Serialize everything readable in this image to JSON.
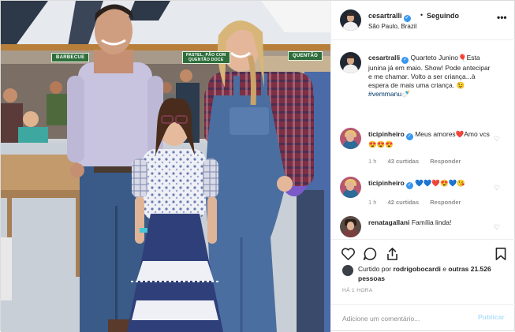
{
  "header": {
    "username": "cesartralli",
    "verified_mark": "✓",
    "separator": "•",
    "follow_status": "Seguindo",
    "location": "São Paulo, Brazil",
    "more_icon": "more-horizontal-icon"
  },
  "photo": {
    "signs": [
      "BARBECUE",
      "PASTEL, PÃO COM\nQUENTÃO DOCE",
      "QUENTÃO"
    ]
  },
  "comments": [
    {
      "username": "cesartralli",
      "verified": true,
      "text": "Quarteto Junino🎈Esta junina já em maio. Show! Pode antecipar e me chamar. Volto a ser criança...à espera de mais uma criança. 😉",
      "hashtag": "#vemmanu🍼",
      "time": "",
      "likes": "",
      "reply": ""
    },
    {
      "username": "ticipinheiro",
      "verified": true,
      "text": "Meus amores❤️Amo vcs 😍😍😍",
      "time": "1 h",
      "likes": "43 curtidas",
      "reply": "Responder"
    },
    {
      "username": "ticipinheiro",
      "verified": true,
      "text": "💙💙❤️😍💙😘",
      "time": "1 h",
      "likes": "42 curtidas",
      "reply": "Responder"
    },
    {
      "username": "renatagallani",
      "verified": false,
      "text": "Família linda!",
      "time": "",
      "likes": "",
      "reply": ""
    }
  ],
  "actions": {
    "icons": [
      "heart-icon",
      "comment-icon",
      "share-icon",
      "bookmark-icon"
    ]
  },
  "likes": {
    "prefix": "Curtido por",
    "user": "rodrigobocardi",
    "connector": "e",
    "others": "outras 21.526 pessoas"
  },
  "time_ago": "HÁ 1 HORA",
  "add_comment": {
    "placeholder": "Adicione um comentário...",
    "publish_label": "Publicar"
  },
  "colors": {
    "link_blue": "#3897f0",
    "publish_disabled": "#b2dffc",
    "muted": "#8e8e8e"
  }
}
